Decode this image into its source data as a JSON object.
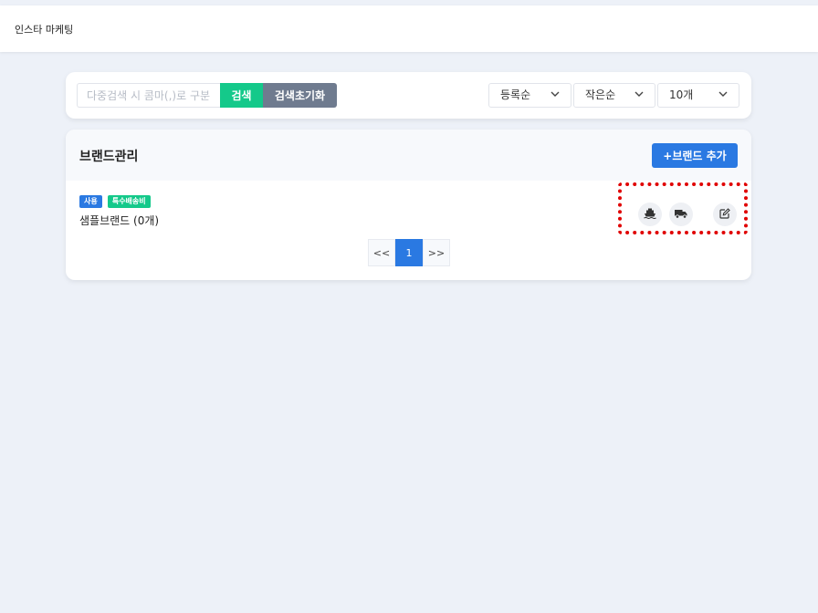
{
  "header": {
    "title": "인스타 마케팅"
  },
  "search": {
    "placeholder": "다중검색 시 콤마(,)로 구분",
    "search_label": "검색",
    "reset_label": "검색초기화"
  },
  "filters": {
    "sort_order": "등록순",
    "size_order": "작은순",
    "per_page": "10개"
  },
  "brand_section": {
    "title": "브랜드관리",
    "add_label": "+브랜드 추가",
    "items": [
      {
        "badges": [
          "사용",
          "특수배송비"
        ],
        "name": "샘플브랜드 (0개)"
      }
    ]
  },
  "pagination": {
    "prev": "<<",
    "current": "1",
    "next": ">>"
  },
  "colors": {
    "accent_blue": "#2a79e2",
    "accent_green": "#14c98a",
    "reset_gray": "#6f7b8f",
    "highlight_red": "#e00000"
  },
  "icons": [
    "ship-icon",
    "truck-icon",
    "edit-icon",
    "chevron-down-icon"
  ]
}
